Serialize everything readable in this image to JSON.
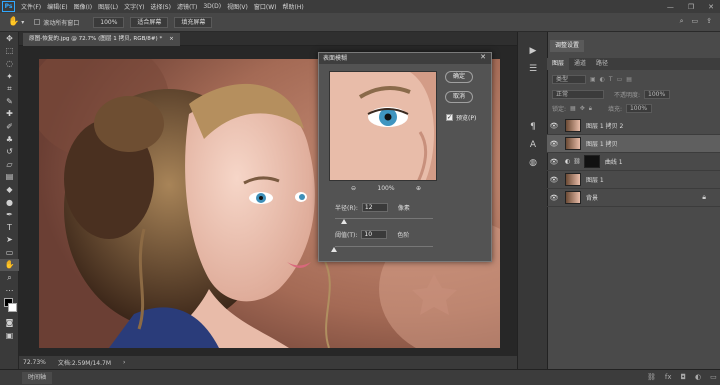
{
  "app": {
    "logo": "Ps"
  },
  "menu": [
    "文件(F)",
    "编辑(E)",
    "图像(I)",
    "图层(L)",
    "文字(Y)",
    "选择(S)",
    "滤镜(T)",
    "3D(D)",
    "视图(V)",
    "窗口(W)",
    "帮助(H)"
  ],
  "window_controls": [
    "—",
    "❐",
    "✕"
  ],
  "options_bar": {
    "scroll_all_label": "滚动所有窗口",
    "zoom_value": "100%",
    "fit_screen": "适合屏幕",
    "fill_screen": "填充屏幕"
  },
  "document_tab": "原图-恢复的.jpg @ 72.7% (图层 1 拷贝, RGB/8#) *",
  "document_tab_close": "×",
  "status": {
    "zoom": "72.73%",
    "doc": "文档:2.59M/14.7M"
  },
  "timeline_tab": "时间轴",
  "history_tab": "调整设置",
  "layers_panel": {
    "tabs": [
      "图层",
      "通道",
      "路径"
    ],
    "kind_placeholder": "类型",
    "blend_mode": "正常",
    "opacity_label": "不透明度:",
    "opacity_value": "100%",
    "lock_label": "锁定:",
    "fill_label": "填充:",
    "fill_value": "100%",
    "layers": [
      {
        "name": "图层 1 拷贝 2",
        "selected": false
      },
      {
        "name": "图层 1 拷贝",
        "selected": true
      },
      {
        "name": "曲线 1",
        "selected": false
      },
      {
        "name": "图层 1",
        "selected": false
      },
      {
        "name": "背景",
        "selected": false
      }
    ]
  },
  "dialog": {
    "title": "表面模糊",
    "ok": "确定",
    "cancel": "取消",
    "preview_label": "预览(P)",
    "preview_checked": true,
    "zoom": "100%",
    "radius_label": "半径(R):",
    "radius_value": "12",
    "radius_unit": "像素",
    "threshold_label": "阈值(T):",
    "threshold_value": "10",
    "threshold_unit": "色阶"
  },
  "colors": {
    "accent": "#31a8ff",
    "panel": "#4a4a4a",
    "dialog": "#535353"
  }
}
